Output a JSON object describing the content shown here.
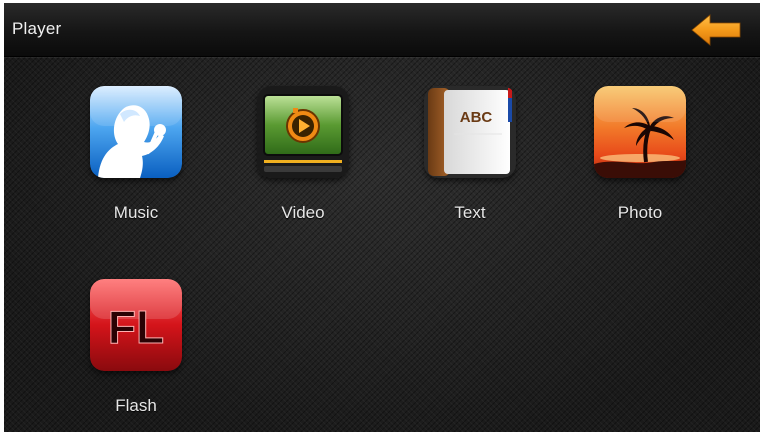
{
  "window": {
    "title": "Player"
  },
  "apps": [
    {
      "label": "Music",
      "icon": "music-icon"
    },
    {
      "label": "Video",
      "icon": "video-icon"
    },
    {
      "label": "Text",
      "icon": "text-icon"
    },
    {
      "label": "Photo",
      "icon": "photo-icon"
    },
    {
      "label": "Flash",
      "icon": "flash-icon"
    }
  ],
  "icons": {
    "text_badge": "ABC",
    "flash_badge": "FL",
    "back": "back-arrow-icon"
  },
  "colors": {
    "background": "#1e1e1e",
    "title_text": "#f0f0f0",
    "label_text": "#e6e6e6",
    "back_arrow": "#f59a1a"
  }
}
